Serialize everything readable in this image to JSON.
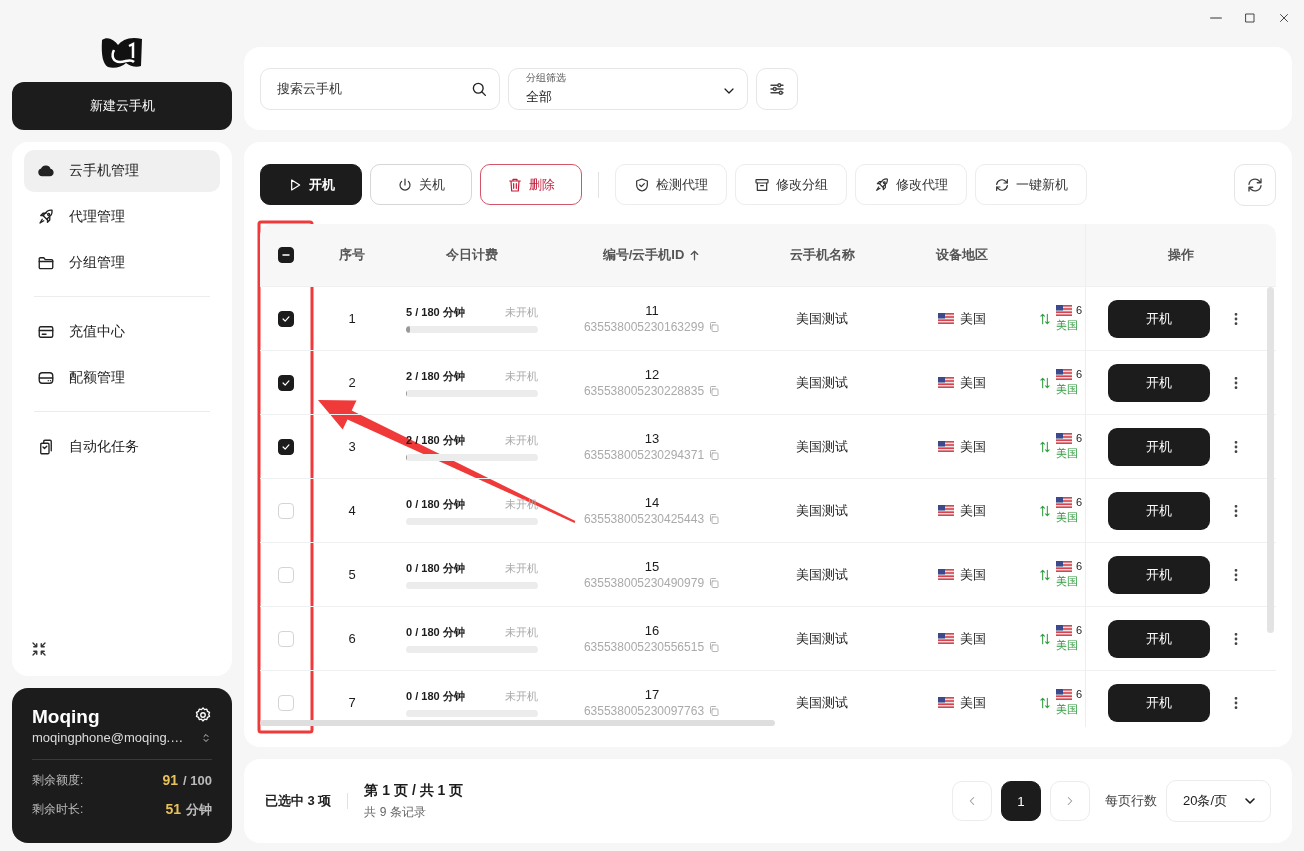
{
  "sidebar": {
    "new_button": "新建云手机",
    "nav_groups": [
      [
        {
          "label": "云手机管理",
          "selected": true
        },
        {
          "label": "代理管理",
          "selected": false
        },
        {
          "label": "分组管理",
          "selected": false
        }
      ],
      [
        {
          "label": "充值中心",
          "selected": false
        },
        {
          "label": "配额管理",
          "selected": false
        }
      ],
      [
        {
          "label": "自动化任务",
          "selected": false
        }
      ]
    ]
  },
  "account": {
    "name": "Moqing",
    "email": "moqingphone@moqing.…",
    "quota_label": "剩余额度:",
    "quota_value": "91",
    "quota_total": "/ 100",
    "time_label": "剩余时长:",
    "time_value": "51",
    "time_unit": "分钟"
  },
  "search": {
    "placeholder": "搜索云手机"
  },
  "group_filter": {
    "label": "分组筛选",
    "value": "全部"
  },
  "toolbar": [
    [
      {
        "label": "开机",
        "kind": "primary"
      },
      {
        "label": "关机",
        "kind": "outline"
      },
      {
        "label": "删除",
        "kind": "danger"
      }
    ],
    [
      {
        "label": "检测代理",
        "kind": "plain"
      },
      {
        "label": "修改分组",
        "kind": "plain"
      },
      {
        "label": "修改代理",
        "kind": "plain"
      },
      {
        "label": "一键新机",
        "kind": "plain"
      }
    ]
  ],
  "table": {
    "header_checkbox": {
      "indeterminate": true
    },
    "columns": [
      "序号",
      "今日计费",
      "编号/云手机ID",
      "云手机名称",
      "设备地区",
      "操作"
    ],
    "rows": [
      {
        "checked": true,
        "index": "1",
        "usage": "5 / 180 分钟",
        "level": 0.028,
        "status": "未开机",
        "number": "11",
        "device_id": "635538005230163299",
        "name": "美国测试",
        "region": "美国",
        "proxy_value": "6",
        "proxy_region": "美国",
        "action": "开机"
      },
      {
        "checked": true,
        "index": "2",
        "usage": "2 / 180 分钟",
        "level": 0.011,
        "status": "未开机",
        "number": "12",
        "device_id": "635538005230228835",
        "name": "美国测试",
        "region": "美国",
        "proxy_value": "6",
        "proxy_region": "美国",
        "action": "开机"
      },
      {
        "checked": true,
        "index": "3",
        "usage": "2 / 180 分钟",
        "level": 0.011,
        "status": "未开机",
        "number": "13",
        "device_id": "635538005230294371",
        "name": "美国测试",
        "region": "美国",
        "proxy_value": "6",
        "proxy_region": "美国",
        "action": "开机"
      },
      {
        "checked": false,
        "index": "4",
        "usage": "0 / 180 分钟",
        "level": 0,
        "status": "未开机",
        "number": "14",
        "device_id": "635538005230425443",
        "name": "美国测试",
        "region": "美国",
        "proxy_value": "6",
        "proxy_region": "美国",
        "action": "开机"
      },
      {
        "checked": false,
        "index": "5",
        "usage": "0 / 180 分钟",
        "level": 0,
        "status": "未开机",
        "number": "15",
        "device_id": "635538005230490979",
        "name": "美国测试",
        "region": "美国",
        "proxy_value": "6",
        "proxy_region": "美国",
        "action": "开机"
      },
      {
        "checked": false,
        "index": "6",
        "usage": "0 / 180 分钟",
        "level": 0,
        "status": "未开机",
        "number": "16",
        "device_id": "635538005230556515",
        "name": "美国测试",
        "region": "美国",
        "proxy_value": "6",
        "proxy_region": "美国",
        "action": "开机"
      },
      {
        "checked": false,
        "index": "7",
        "usage": "0 / 180 分钟",
        "level": 0,
        "status": "未开机",
        "number": "17",
        "device_id": "635538005230097763",
        "name": "美国测试",
        "region": "美国",
        "proxy_value": "6",
        "proxy_region": "美国",
        "action": "开机"
      }
    ]
  },
  "highlight": {
    "frame": true,
    "arrow": true
  },
  "footer": {
    "selected": "已选中 3 项",
    "page": "第 1 页 / 共 1 页",
    "total": "共 9 条记录",
    "pages": [
      {
        "label": "1",
        "selected": true
      }
    ],
    "rows_per_page_label": "每页行数",
    "rows_per_page": "20条/页"
  }
}
